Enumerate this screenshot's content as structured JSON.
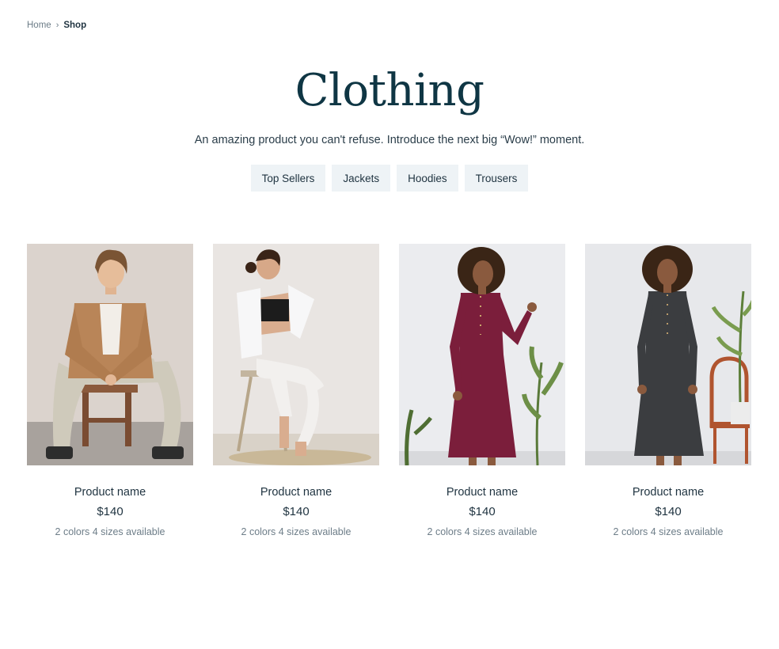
{
  "breadcrumb": {
    "home": "Home",
    "current": "Shop"
  },
  "header": {
    "title": "Clothing",
    "subtitle": "An amazing product you can't refuse. Introduce the next big “Wow!” moment."
  },
  "filters": [
    "Top Sellers",
    "Jackets",
    "Hoodies",
    "Trousers"
  ],
  "products": [
    {
      "name": "Product name",
      "price": "$140",
      "availability": "2 colors 4 sizes available"
    },
    {
      "name": "Product name",
      "price": "$140",
      "availability": "2 colors 4 sizes available"
    },
    {
      "name": "Product name",
      "price": "$140",
      "availability": "2 colors 4 sizes available"
    },
    {
      "name": "Product name",
      "price": "$140",
      "availability": "2 colors 4 sizes available"
    }
  ],
  "colors": {
    "title": "#0f3644",
    "text": "#1f3340",
    "muted": "#6d7d88",
    "chip_bg": "#eef3f6"
  }
}
